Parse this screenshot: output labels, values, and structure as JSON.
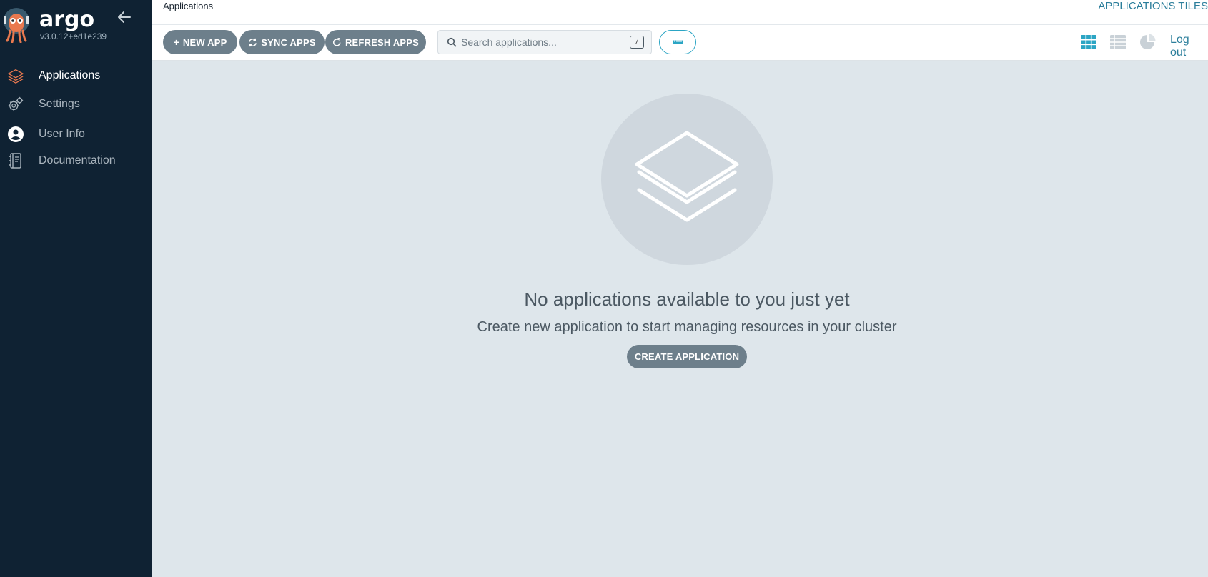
{
  "app": {
    "logo_text": "argo",
    "version": "v3.0.12+ed1e239"
  },
  "sidebar": {
    "items": [
      {
        "label": "Applications",
        "icon": "layers-icon",
        "active": true
      },
      {
        "label": "Settings",
        "icon": "gears-icon",
        "active": false
      },
      {
        "label": "User Info",
        "icon": "user-circle-icon",
        "active": false
      },
      {
        "label": "Documentation",
        "icon": "book-icon",
        "active": false
      }
    ]
  },
  "header": {
    "breadcrumb": "Applications",
    "title": "APPLICATIONS TILES"
  },
  "toolbar": {
    "new_app": "NEW APP",
    "sync_apps": "SYNC APPS",
    "refresh_apps": "REFRESH APPS",
    "search_placeholder": "Search applications...",
    "search_shortcut": "/",
    "logout": "Log out"
  },
  "empty_state": {
    "title": "No applications available to you just yet",
    "subtitle": "Create new application to start managing resources in your cluster",
    "create_button": "CREATE APPLICATION"
  },
  "colors": {
    "sidebar_bg": "#0f2233",
    "content_bg": "#dee6eb",
    "accent": "#2ba5c4",
    "button_bg": "#6d7f8b"
  }
}
